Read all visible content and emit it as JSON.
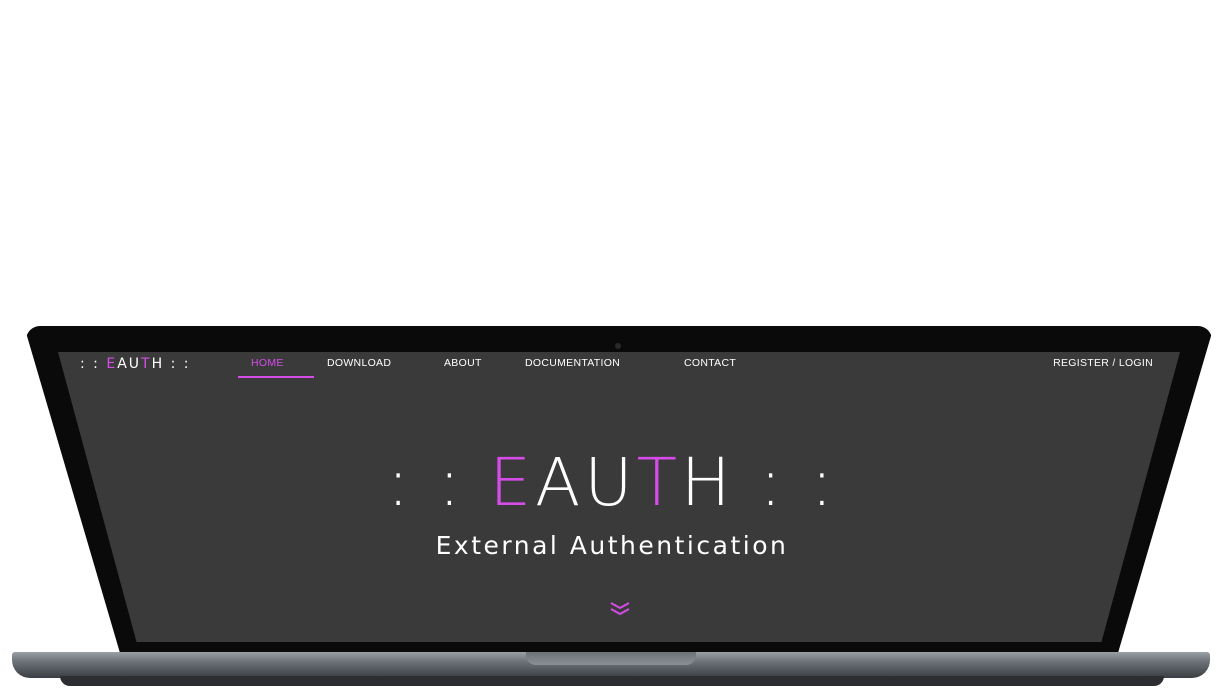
{
  "brand": {
    "logo_prefix": ": : ",
    "logo_letters": [
      "E",
      "A",
      "U",
      "T",
      "H"
    ],
    "logo_suffix": " : :",
    "accent_color": "#d64ce8",
    "background_color": "#3b3a3b"
  },
  "nav": {
    "items": [
      {
        "label": "HOME",
        "active": true
      },
      {
        "label": "DOWNLOAD",
        "active": false
      },
      {
        "label": "ABOUT",
        "active": false
      },
      {
        "label": "DOCUMENTATION",
        "active": false
      },
      {
        "label": "CONTACT",
        "active": false
      }
    ],
    "login_label": "REGISTER / LOGIN"
  },
  "hero": {
    "title_prefix": ": : ",
    "title_letters": [
      "E",
      "A",
      "U",
      "T",
      "H"
    ],
    "title_suffix": " : :",
    "subtitle": "External  Authentication",
    "scroll_icon": "chevron-double-down-icon"
  }
}
